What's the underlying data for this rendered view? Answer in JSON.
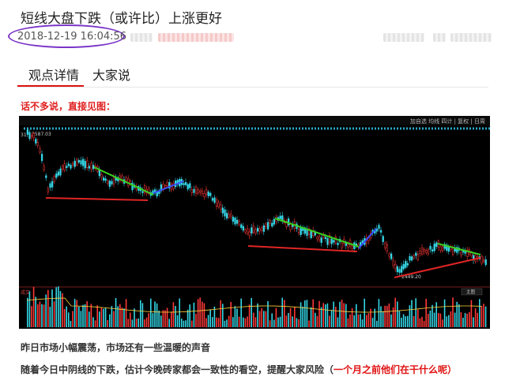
{
  "article": {
    "title": "短线大盘下跌（或许比）上涨更好",
    "date": "2018-12-19 16:04:56"
  },
  "tabs": [
    {
      "label": "观点详情",
      "active": true
    },
    {
      "label": "大家说",
      "active": false
    }
  ],
  "content": {
    "intro": "话不多说，直接见图：",
    "paragraph_1": "昨日市场小幅震荡，市场还有一些温暖的声音",
    "paragraph_2_text": "随着今日中阴线的下跌，估计今晚砖家都会一致性的看空，提醒大家风险（",
    "paragraph_2_highlight": "一个月之前他们在干什么呢",
    "paragraph_2_end": "）"
  },
  "chart_labels": {
    "top_right": "加自选 均线 四计 | 复权 | 日周",
    "high_label": "3587.03",
    "low_label": "2449.20",
    "left_top": "31",
    "volume_label": "成交",
    "volume_right": "主图"
  },
  "colors": {
    "accent_red": "#e02020",
    "date_circle": "#7a35c8",
    "trend_green": "#39d01f",
    "trend_red": "#e02525",
    "trend_blue": "#3a4cff"
  }
}
